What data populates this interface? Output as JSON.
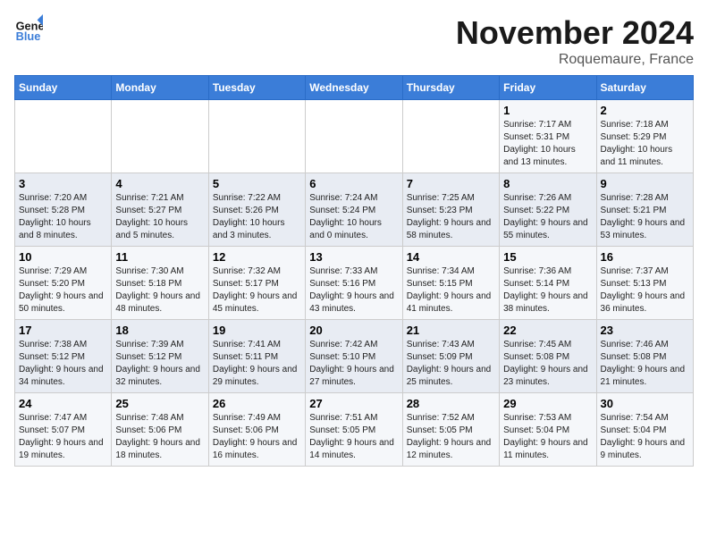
{
  "header": {
    "logo_general": "General",
    "logo_blue": "Blue",
    "month_title": "November 2024",
    "location": "Roquemaure, France"
  },
  "weekdays": [
    "Sunday",
    "Monday",
    "Tuesday",
    "Wednesday",
    "Thursday",
    "Friday",
    "Saturday"
  ],
  "weeks": [
    [
      {
        "day": "",
        "info": ""
      },
      {
        "day": "",
        "info": ""
      },
      {
        "day": "",
        "info": ""
      },
      {
        "day": "",
        "info": ""
      },
      {
        "day": "",
        "info": ""
      },
      {
        "day": "1",
        "info": "Sunrise: 7:17 AM\nSunset: 5:31 PM\nDaylight: 10 hours and 13 minutes."
      },
      {
        "day": "2",
        "info": "Sunrise: 7:18 AM\nSunset: 5:29 PM\nDaylight: 10 hours and 11 minutes."
      }
    ],
    [
      {
        "day": "3",
        "info": "Sunrise: 7:20 AM\nSunset: 5:28 PM\nDaylight: 10 hours and 8 minutes."
      },
      {
        "day": "4",
        "info": "Sunrise: 7:21 AM\nSunset: 5:27 PM\nDaylight: 10 hours and 5 minutes."
      },
      {
        "day": "5",
        "info": "Sunrise: 7:22 AM\nSunset: 5:26 PM\nDaylight: 10 hours and 3 minutes."
      },
      {
        "day": "6",
        "info": "Sunrise: 7:24 AM\nSunset: 5:24 PM\nDaylight: 10 hours and 0 minutes."
      },
      {
        "day": "7",
        "info": "Sunrise: 7:25 AM\nSunset: 5:23 PM\nDaylight: 9 hours and 58 minutes."
      },
      {
        "day": "8",
        "info": "Sunrise: 7:26 AM\nSunset: 5:22 PM\nDaylight: 9 hours and 55 minutes."
      },
      {
        "day": "9",
        "info": "Sunrise: 7:28 AM\nSunset: 5:21 PM\nDaylight: 9 hours and 53 minutes."
      }
    ],
    [
      {
        "day": "10",
        "info": "Sunrise: 7:29 AM\nSunset: 5:20 PM\nDaylight: 9 hours and 50 minutes."
      },
      {
        "day": "11",
        "info": "Sunrise: 7:30 AM\nSunset: 5:18 PM\nDaylight: 9 hours and 48 minutes."
      },
      {
        "day": "12",
        "info": "Sunrise: 7:32 AM\nSunset: 5:17 PM\nDaylight: 9 hours and 45 minutes."
      },
      {
        "day": "13",
        "info": "Sunrise: 7:33 AM\nSunset: 5:16 PM\nDaylight: 9 hours and 43 minutes."
      },
      {
        "day": "14",
        "info": "Sunrise: 7:34 AM\nSunset: 5:15 PM\nDaylight: 9 hours and 41 minutes."
      },
      {
        "day": "15",
        "info": "Sunrise: 7:36 AM\nSunset: 5:14 PM\nDaylight: 9 hours and 38 minutes."
      },
      {
        "day": "16",
        "info": "Sunrise: 7:37 AM\nSunset: 5:13 PM\nDaylight: 9 hours and 36 minutes."
      }
    ],
    [
      {
        "day": "17",
        "info": "Sunrise: 7:38 AM\nSunset: 5:12 PM\nDaylight: 9 hours and 34 minutes."
      },
      {
        "day": "18",
        "info": "Sunrise: 7:39 AM\nSunset: 5:12 PM\nDaylight: 9 hours and 32 minutes."
      },
      {
        "day": "19",
        "info": "Sunrise: 7:41 AM\nSunset: 5:11 PM\nDaylight: 9 hours and 29 minutes."
      },
      {
        "day": "20",
        "info": "Sunrise: 7:42 AM\nSunset: 5:10 PM\nDaylight: 9 hours and 27 minutes."
      },
      {
        "day": "21",
        "info": "Sunrise: 7:43 AM\nSunset: 5:09 PM\nDaylight: 9 hours and 25 minutes."
      },
      {
        "day": "22",
        "info": "Sunrise: 7:45 AM\nSunset: 5:08 PM\nDaylight: 9 hours and 23 minutes."
      },
      {
        "day": "23",
        "info": "Sunrise: 7:46 AM\nSunset: 5:08 PM\nDaylight: 9 hours and 21 minutes."
      }
    ],
    [
      {
        "day": "24",
        "info": "Sunrise: 7:47 AM\nSunset: 5:07 PM\nDaylight: 9 hours and 19 minutes."
      },
      {
        "day": "25",
        "info": "Sunrise: 7:48 AM\nSunset: 5:06 PM\nDaylight: 9 hours and 18 minutes."
      },
      {
        "day": "26",
        "info": "Sunrise: 7:49 AM\nSunset: 5:06 PM\nDaylight: 9 hours and 16 minutes."
      },
      {
        "day": "27",
        "info": "Sunrise: 7:51 AM\nSunset: 5:05 PM\nDaylight: 9 hours and 14 minutes."
      },
      {
        "day": "28",
        "info": "Sunrise: 7:52 AM\nSunset: 5:05 PM\nDaylight: 9 hours and 12 minutes."
      },
      {
        "day": "29",
        "info": "Sunrise: 7:53 AM\nSunset: 5:04 PM\nDaylight: 9 hours and 11 minutes."
      },
      {
        "day": "30",
        "info": "Sunrise: 7:54 AM\nSunset: 5:04 PM\nDaylight: 9 hours and 9 minutes."
      }
    ]
  ]
}
